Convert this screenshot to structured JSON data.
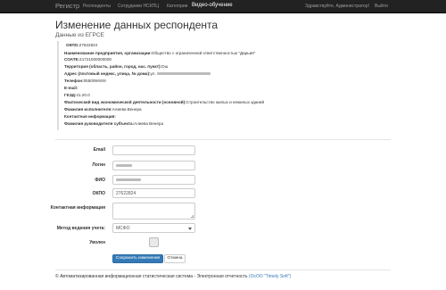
{
  "navbar": {
    "brand": "Регистр",
    "items": [
      "Респонденты",
      "Сотрудники НСКПЦ",
      "Категории",
      "Видео-обучение"
    ],
    "greeting": "Здравствуйте, Администратор!",
    "logout": "Выйти"
  },
  "page": {
    "title": "Изменение данных респондента",
    "subtitle": "Данные из ЕГРСЕ"
  },
  "info": {
    "okpo": {
      "label": "ОКПО:",
      "value": "27622824"
    },
    "org_name": {
      "label": "Наименование предприятия, организации:",
      "value": "Общество с ограниченной ответственностью \"Дарьия\""
    },
    "soate": {
      "label": "СОАТЕ:",
      "value": "41721000000000"
    },
    "territory": {
      "label": "Территория (область, район, город, нас. пункт):",
      "value": "Ош"
    },
    "address": {
      "label": "Адрес (почтовый индекс, улица, № дома):",
      "value": "ул. "
    },
    "phone": {
      "label": "Телефон:",
      "value": "055009"
    },
    "email": {
      "label": "E-mail:",
      "value": ""
    },
    "gked": {
      "label": "ГКЭД:",
      "value": "41.20.0"
    },
    "activity": {
      "label": "Фактический вид экономической деятельности (основной):",
      "value": "Строительство жилых и нежилых зданий"
    },
    "executor": {
      "label": "Фамилия исполнителя:",
      "value": "Алиева Венера"
    },
    "contact": {
      "label": "Контактная информация:",
      "value": ""
    },
    "head": {
      "label": "Фамилия руководителя субъекта:",
      "value": "Алиева Венера"
    }
  },
  "form": {
    "email_label": "Email",
    "login_label": "Логин",
    "fio_label": "ФИО",
    "okpo_label": "ОКПО",
    "okpo_value": "27622824",
    "contact_label": "Контактная информация",
    "method_label": "Метод ведения учета:",
    "method_value": "МСФО",
    "fired_label": "Уволен",
    "save_button": "Сохранить изменения",
    "cancel_button": "Отмена"
  },
  "footer": {
    "text": "© Автоматизированная информационная статистическая система - Электронная отчетность",
    "link": "(ОсОО \"Timely Soft\")"
  }
}
